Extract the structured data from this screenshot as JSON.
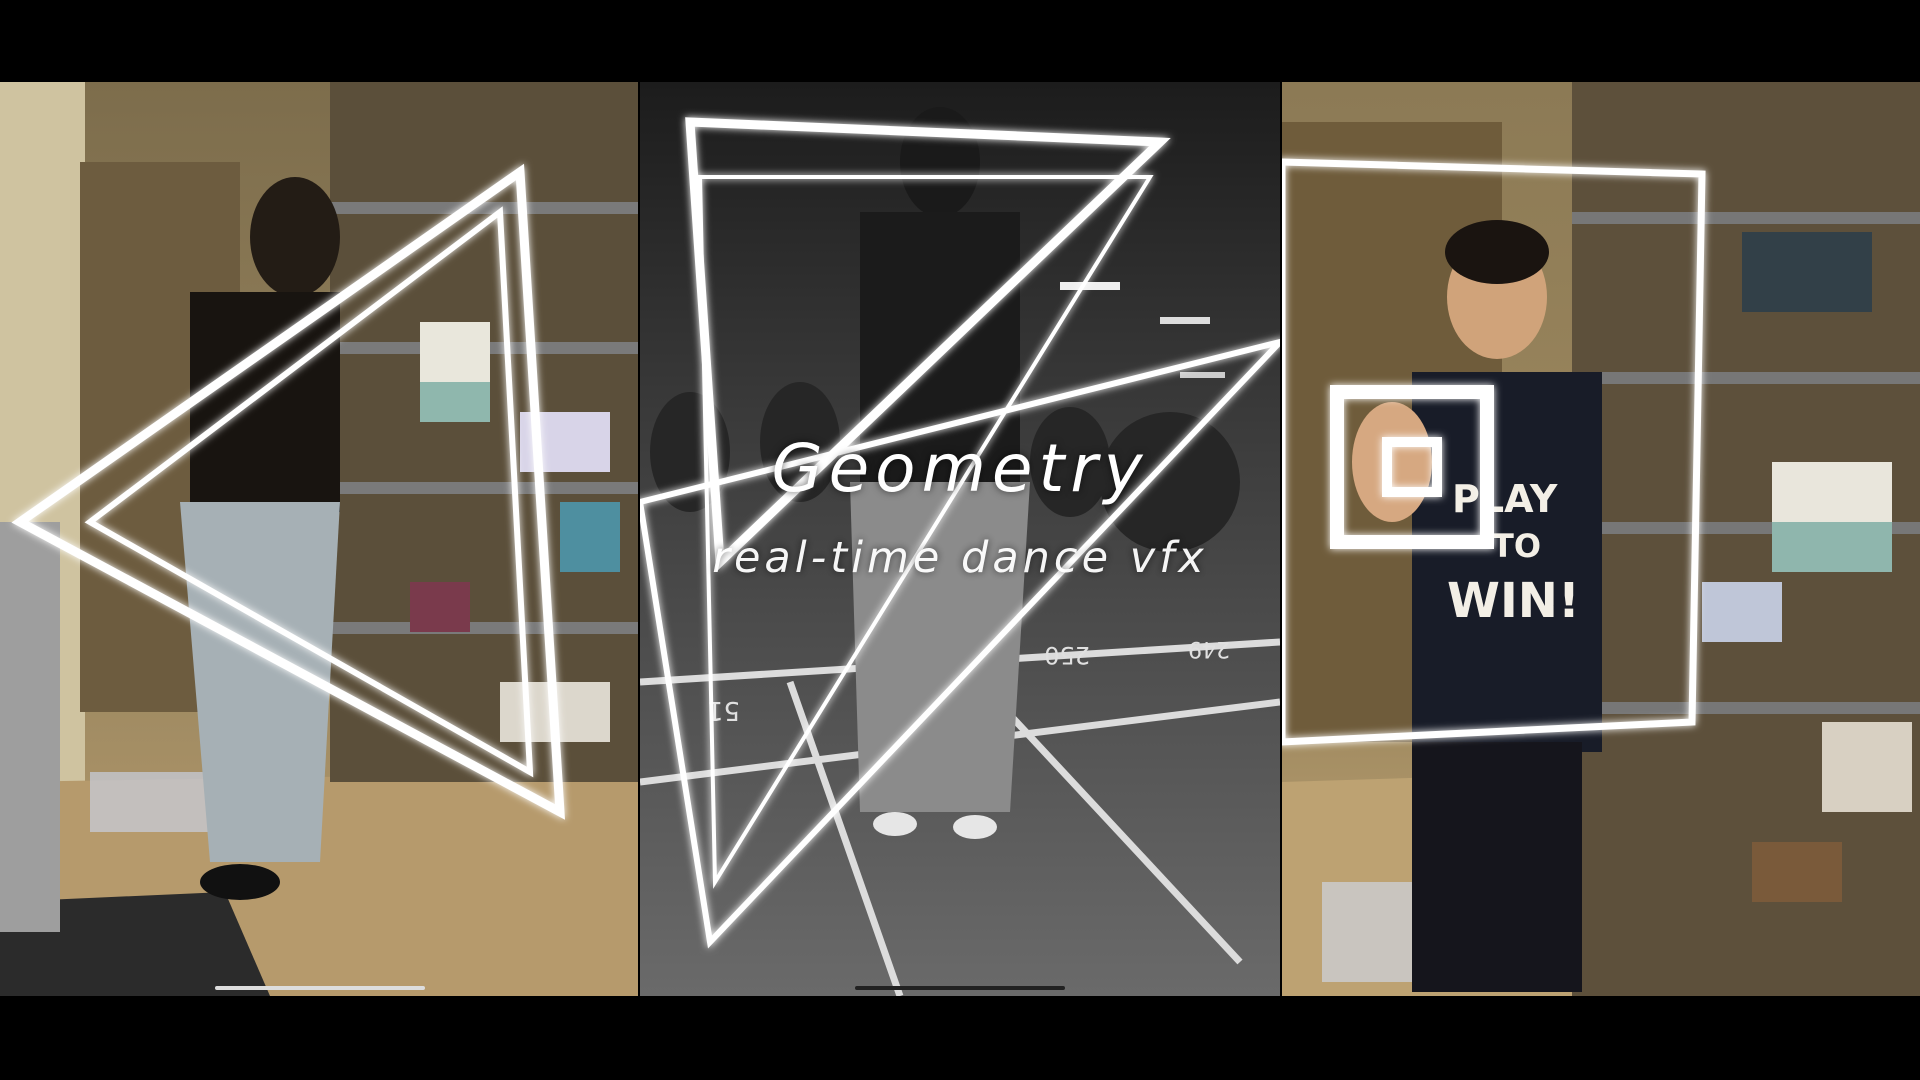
{
  "title": "Geometry",
  "subtitle": "real-time dance vfx",
  "shirt_text": [
    "PLAY",
    "TO",
    "WIN!"
  ],
  "parking_numbers": [
    "51",
    "250",
    "249"
  ],
  "colors": {
    "letterbox": "#000000",
    "line_glow": "#ffffff",
    "warm_room": "#9b8a62",
    "warm_floor": "#b79a6e",
    "parking_gray": "#5a5a5a"
  },
  "panels": [
    {
      "name": "left-panel",
      "scene": "dancer in storage room with glowing triangle outlines",
      "effect": "triangle-outlines"
    },
    {
      "name": "center-panel",
      "scene": "dancer in grayscale parking garage with inverted triangle outlines",
      "effect": "inverted-triangles"
    },
    {
      "name": "right-panel",
      "scene": "person in storage room with square outlines around hand",
      "effect": "square-outlines"
    }
  ]
}
